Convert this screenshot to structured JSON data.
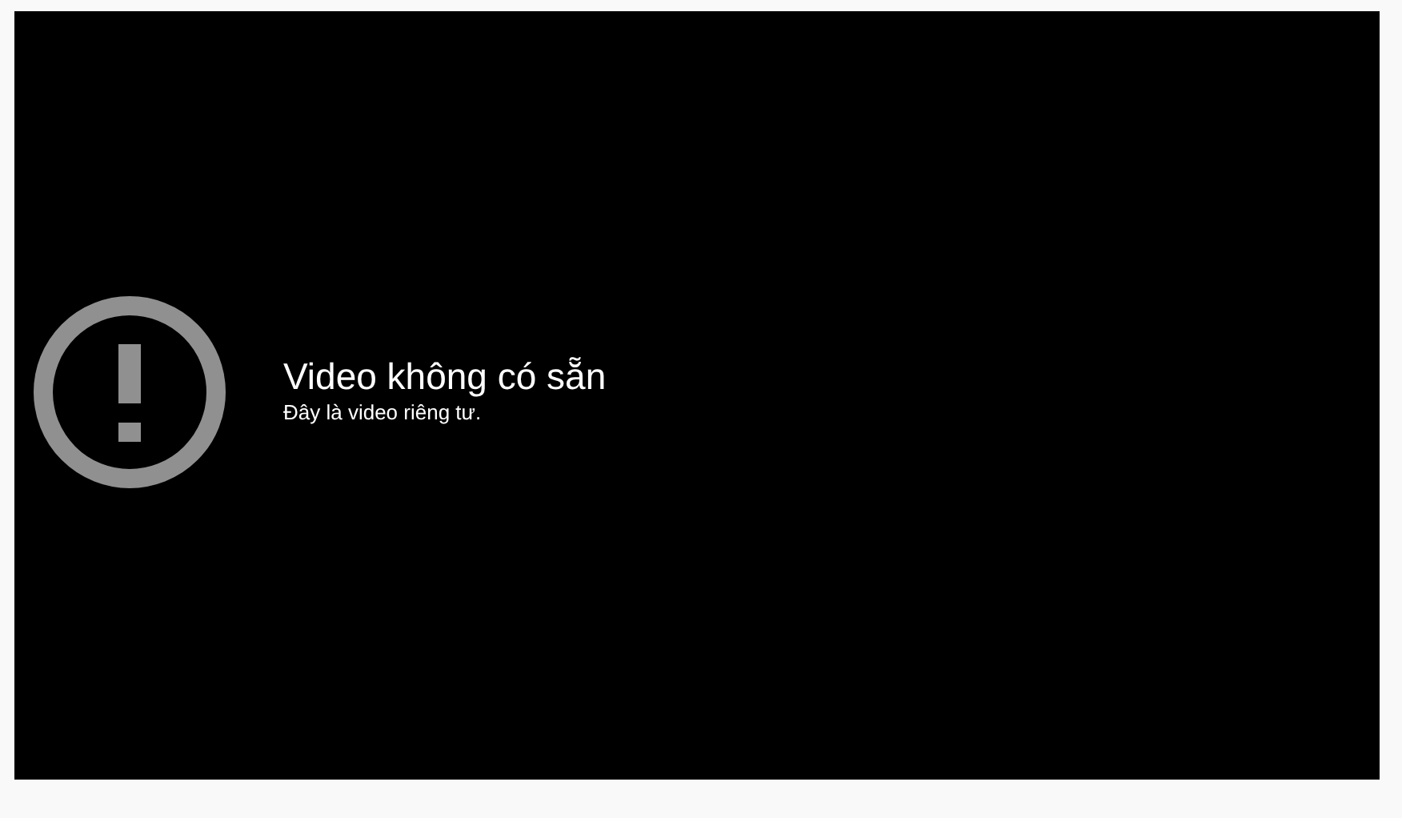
{
  "player": {
    "error_title": "Video không có sẵn",
    "error_reason": "Đây là video riêng tư."
  }
}
